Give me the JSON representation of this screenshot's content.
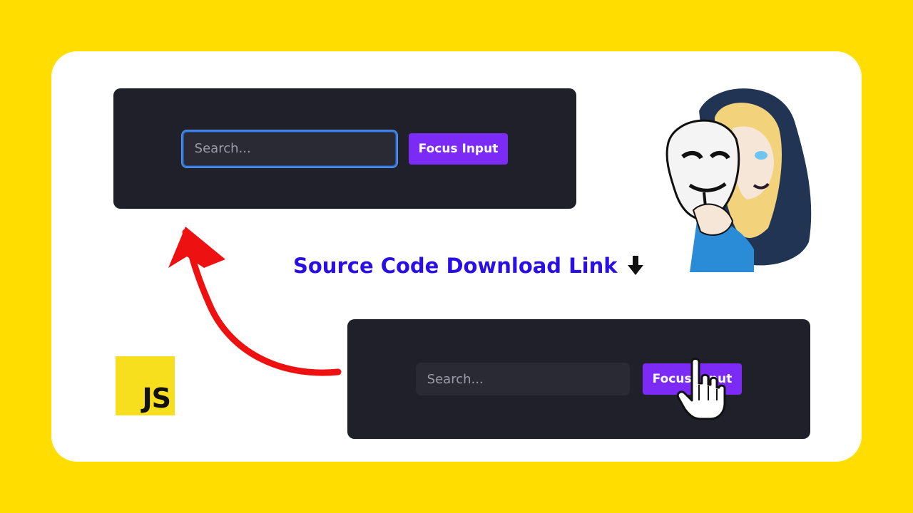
{
  "top_panel": {
    "search_placeholder": "Search...",
    "button_label": "Focus Input",
    "input_state": "focused"
  },
  "bottom_panel": {
    "search_placeholder": "Search...",
    "button_label": "Focus Input",
    "cursor": "hand-pointer-icon"
  },
  "headline": {
    "text": "Source Code Download Link",
    "icon": "down-arrow-icon"
  },
  "js_logo": {
    "text": "JS"
  },
  "colors": {
    "background": "#FFDD00",
    "card": "#FFFFFF",
    "panel": "#1F2029",
    "button": "#7C2BF7",
    "focus_ring": "#3D7BDA",
    "headline": "#2A0EE6",
    "arrow": "#EE1111",
    "js_yellow": "#F7DF1E"
  }
}
